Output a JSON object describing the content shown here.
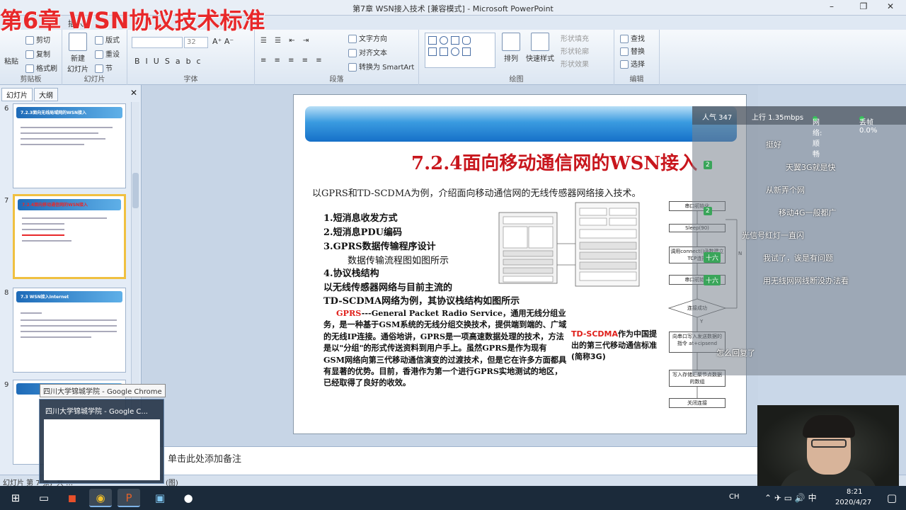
{
  "window": {
    "title": "第7章 WSN接入技术 [兼容模式] - Microsoft PowerPoint",
    "overlay_title": "第6章 WSN协议技术标准"
  },
  "ribbon": {
    "tab_insert": "插入",
    "clipboard": {
      "cut": "剪切",
      "copy": "复制",
      "format_painter": "格式刷",
      "paste": "粘贴",
      "group": "剪贴板"
    },
    "slides": {
      "new_slide": "新建",
      "new_slide2": "幻灯片",
      "layout": "版式",
      "reset": "重设",
      "section": "节",
      "group": "幻灯片"
    },
    "font": {
      "size": "32",
      "group": "字体"
    },
    "paragraph": {
      "text_direction": "文字方向",
      "align_text": "对齐文本",
      "smartart": "转换为 SmartArt",
      "group": "段落"
    },
    "drawing": {
      "arrange": "排列",
      "quick_styles": "快速样式",
      "shape_fill": "形状填充",
      "shape_outline": "形状轮廓",
      "shape_effects": "形状效果",
      "group": "绘图"
    },
    "editing": {
      "find": "查找",
      "replace": "替换",
      "select": "选择",
      "group": "编辑"
    }
  },
  "left_pane": {
    "tab_slides": "幻灯片",
    "tab_outline": "大纲",
    "thumbnails": [
      {
        "num": "6",
        "title": "7.2.3面向无线局域网的WSN接入"
      },
      {
        "num": "7",
        "title": "7.2.4面向移动通信网的WSN接入"
      },
      {
        "num": "8",
        "title": "7.3 WSN接入Internet"
      },
      {
        "num": "9",
        "title": ""
      }
    ]
  },
  "slide": {
    "title": "7.2.4面向移动通信网的WSN接入",
    "intro": "以GPRS和TD-SCDMA为例，介绍面向移动通信网的无线传感器网络接入技术。",
    "items": [
      "1.短消息收发方式",
      "2.短消息PDU编码",
      "3.GPRS数据传输程序设计",
      "数据传输流程图如图所示",
      "4.协议栈结构",
      "以无线传感器网络与目前主流的",
      "TD-SCDMA网络为例，其协议栈结构如图所示"
    ],
    "gprs_label": "GPRS",
    "gprs_text": "---General Packet Radio Service，通用无线分组业务，是一种基于GSM系统的无线分组交换技术，提供端到端的、广域的无线IP连接。通俗地讲，GPRS是一项高速数据处理的技术，方法是以\"分组\"的形式传送资料到用户手上。虽然GPRS是作为现有GSM网络向第三代移动通信演变的过渡技术，但是它在许多方面都具有显著的优势。目前，香港作为第一个进行GPRS实地测试的地区，已经取得了良好的收效。",
    "td_label": "TD-SCDMA",
    "td_text": "作为中国提出的第三代移动通信标准(简称3G)",
    "flow": [
      "串口初始化",
      "Sleep(90)",
      "调用connect()函数建立TCP连接",
      "串口初始化",
      "连接成功",
      "向串口写入发送数据的指令 at+cipsend",
      "写入存储汇聚节点数据的数组",
      "关闭连接"
    ],
    "flow_y": "Y",
    "flow_n": "N"
  },
  "notes": {
    "placeholder": "单击此处添加备注"
  },
  "status": {
    "slide_info": "幻灯片 第 7 张，共 …",
    "theme": "(图)"
  },
  "live": {
    "popularity": "人气  347",
    "upload": "上行  1.35mbps",
    "latency": "网络: 顺畅",
    "drop": "丢帧 0.0%",
    "badges": [
      "2",
      "2",
      "十六",
      "十六"
    ],
    "messages": [
      "挺好",
      "天翼3G就是快",
      "从新弄个网",
      "移动4G一般都广",
      "光信号红灯一直闪",
      "我试了，诶是有问题",
      "用无线网网线断没办法看",
      "怎么回复了"
    ]
  },
  "taskbar": {
    "chrome_tooltip": "四川大学锦城学院 - Google Chrome",
    "chrome_preview_title": "四川大学锦城学院 - Google C...",
    "ime": "CH",
    "time": "8:21",
    "date": "2020/4/27"
  },
  "colors": {
    "title_red": "#c8161d",
    "overlay_red": "#e8282a",
    "slide_blue": "#1670c8"
  }
}
